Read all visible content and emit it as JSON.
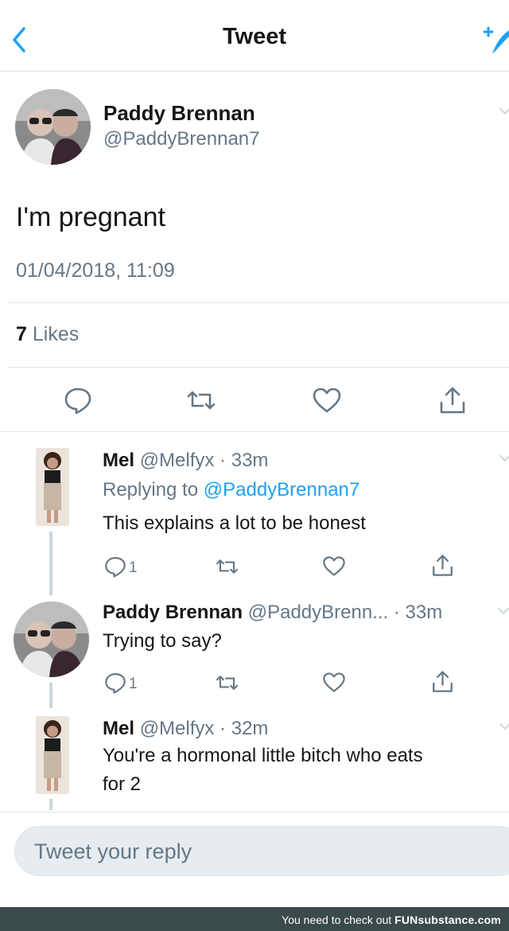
{
  "header": {
    "title": "Tweet"
  },
  "main_tweet": {
    "name": "Paddy Brennan",
    "handle": "@PaddyBrennan7",
    "text": "I'm pregnant",
    "timestamp": "01/04/2018, 11:09",
    "likes_count": "7",
    "likes_label": "Likes"
  },
  "replies": [
    {
      "name": "Mel",
      "meta": "@Melfyx · 33m",
      "replying_prefix": "Replying to",
      "replying_to": "@PaddyBrennan7",
      "text": "This explains a lot to be honest",
      "reply_count": "1"
    },
    {
      "name": "Paddy Brennan",
      "meta": "@PaddyBrenn... · 33m",
      "text": "Trying to say?",
      "reply_count": "1"
    },
    {
      "name": "Mel",
      "meta": "@Melfyx · 32m",
      "text_line1": "You're a hormonal little bitch who eats",
      "text_line2": "for 2"
    }
  ],
  "composer": {
    "placeholder": "Tweet your reply"
  },
  "footer": {
    "prefix": "You need to check out",
    "brand": "FUNsubstance.com"
  },
  "colors": {
    "accent": "#1da1f2",
    "muted": "#657786",
    "icon": "#657786"
  },
  "icons": [
    "back-chevron-icon",
    "compose-icon",
    "reply-icon",
    "retweet-icon",
    "like-icon",
    "share-icon"
  ]
}
